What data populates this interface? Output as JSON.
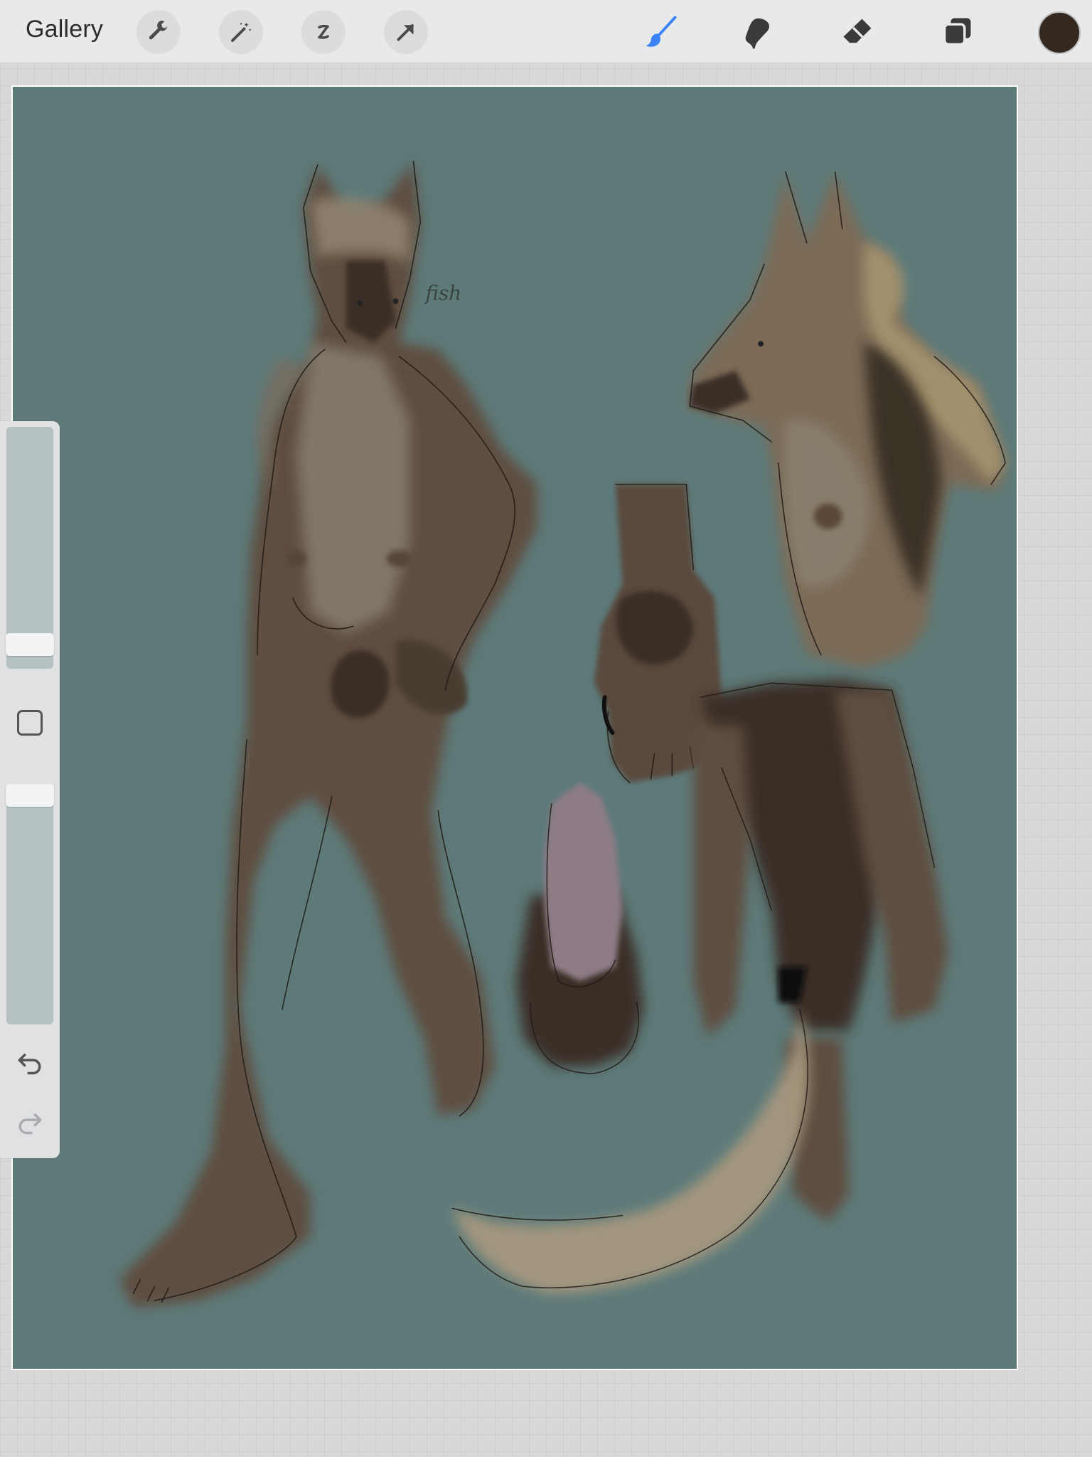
{
  "toolbar": {
    "gallery_label": "Gallery",
    "left_tools": [
      "wrench-icon",
      "magic-wand-icon",
      "selection-icon",
      "transform-arrow-icon"
    ],
    "right_tools": [
      "brush-icon",
      "smudge-icon",
      "eraser-icon",
      "layers-icon"
    ],
    "active_tool": "brush-icon",
    "accent_color": "#3b82f6",
    "current_color": "#35291f"
  },
  "sidebar": {
    "brush_size_level": 0.88,
    "opacity_level": 0.0,
    "buttons": [
      "modify-square-icon",
      "undo-icon",
      "redo-icon"
    ]
  },
  "canvas": {
    "background_color": "#5d7a79",
    "annotation_text": "fish"
  }
}
